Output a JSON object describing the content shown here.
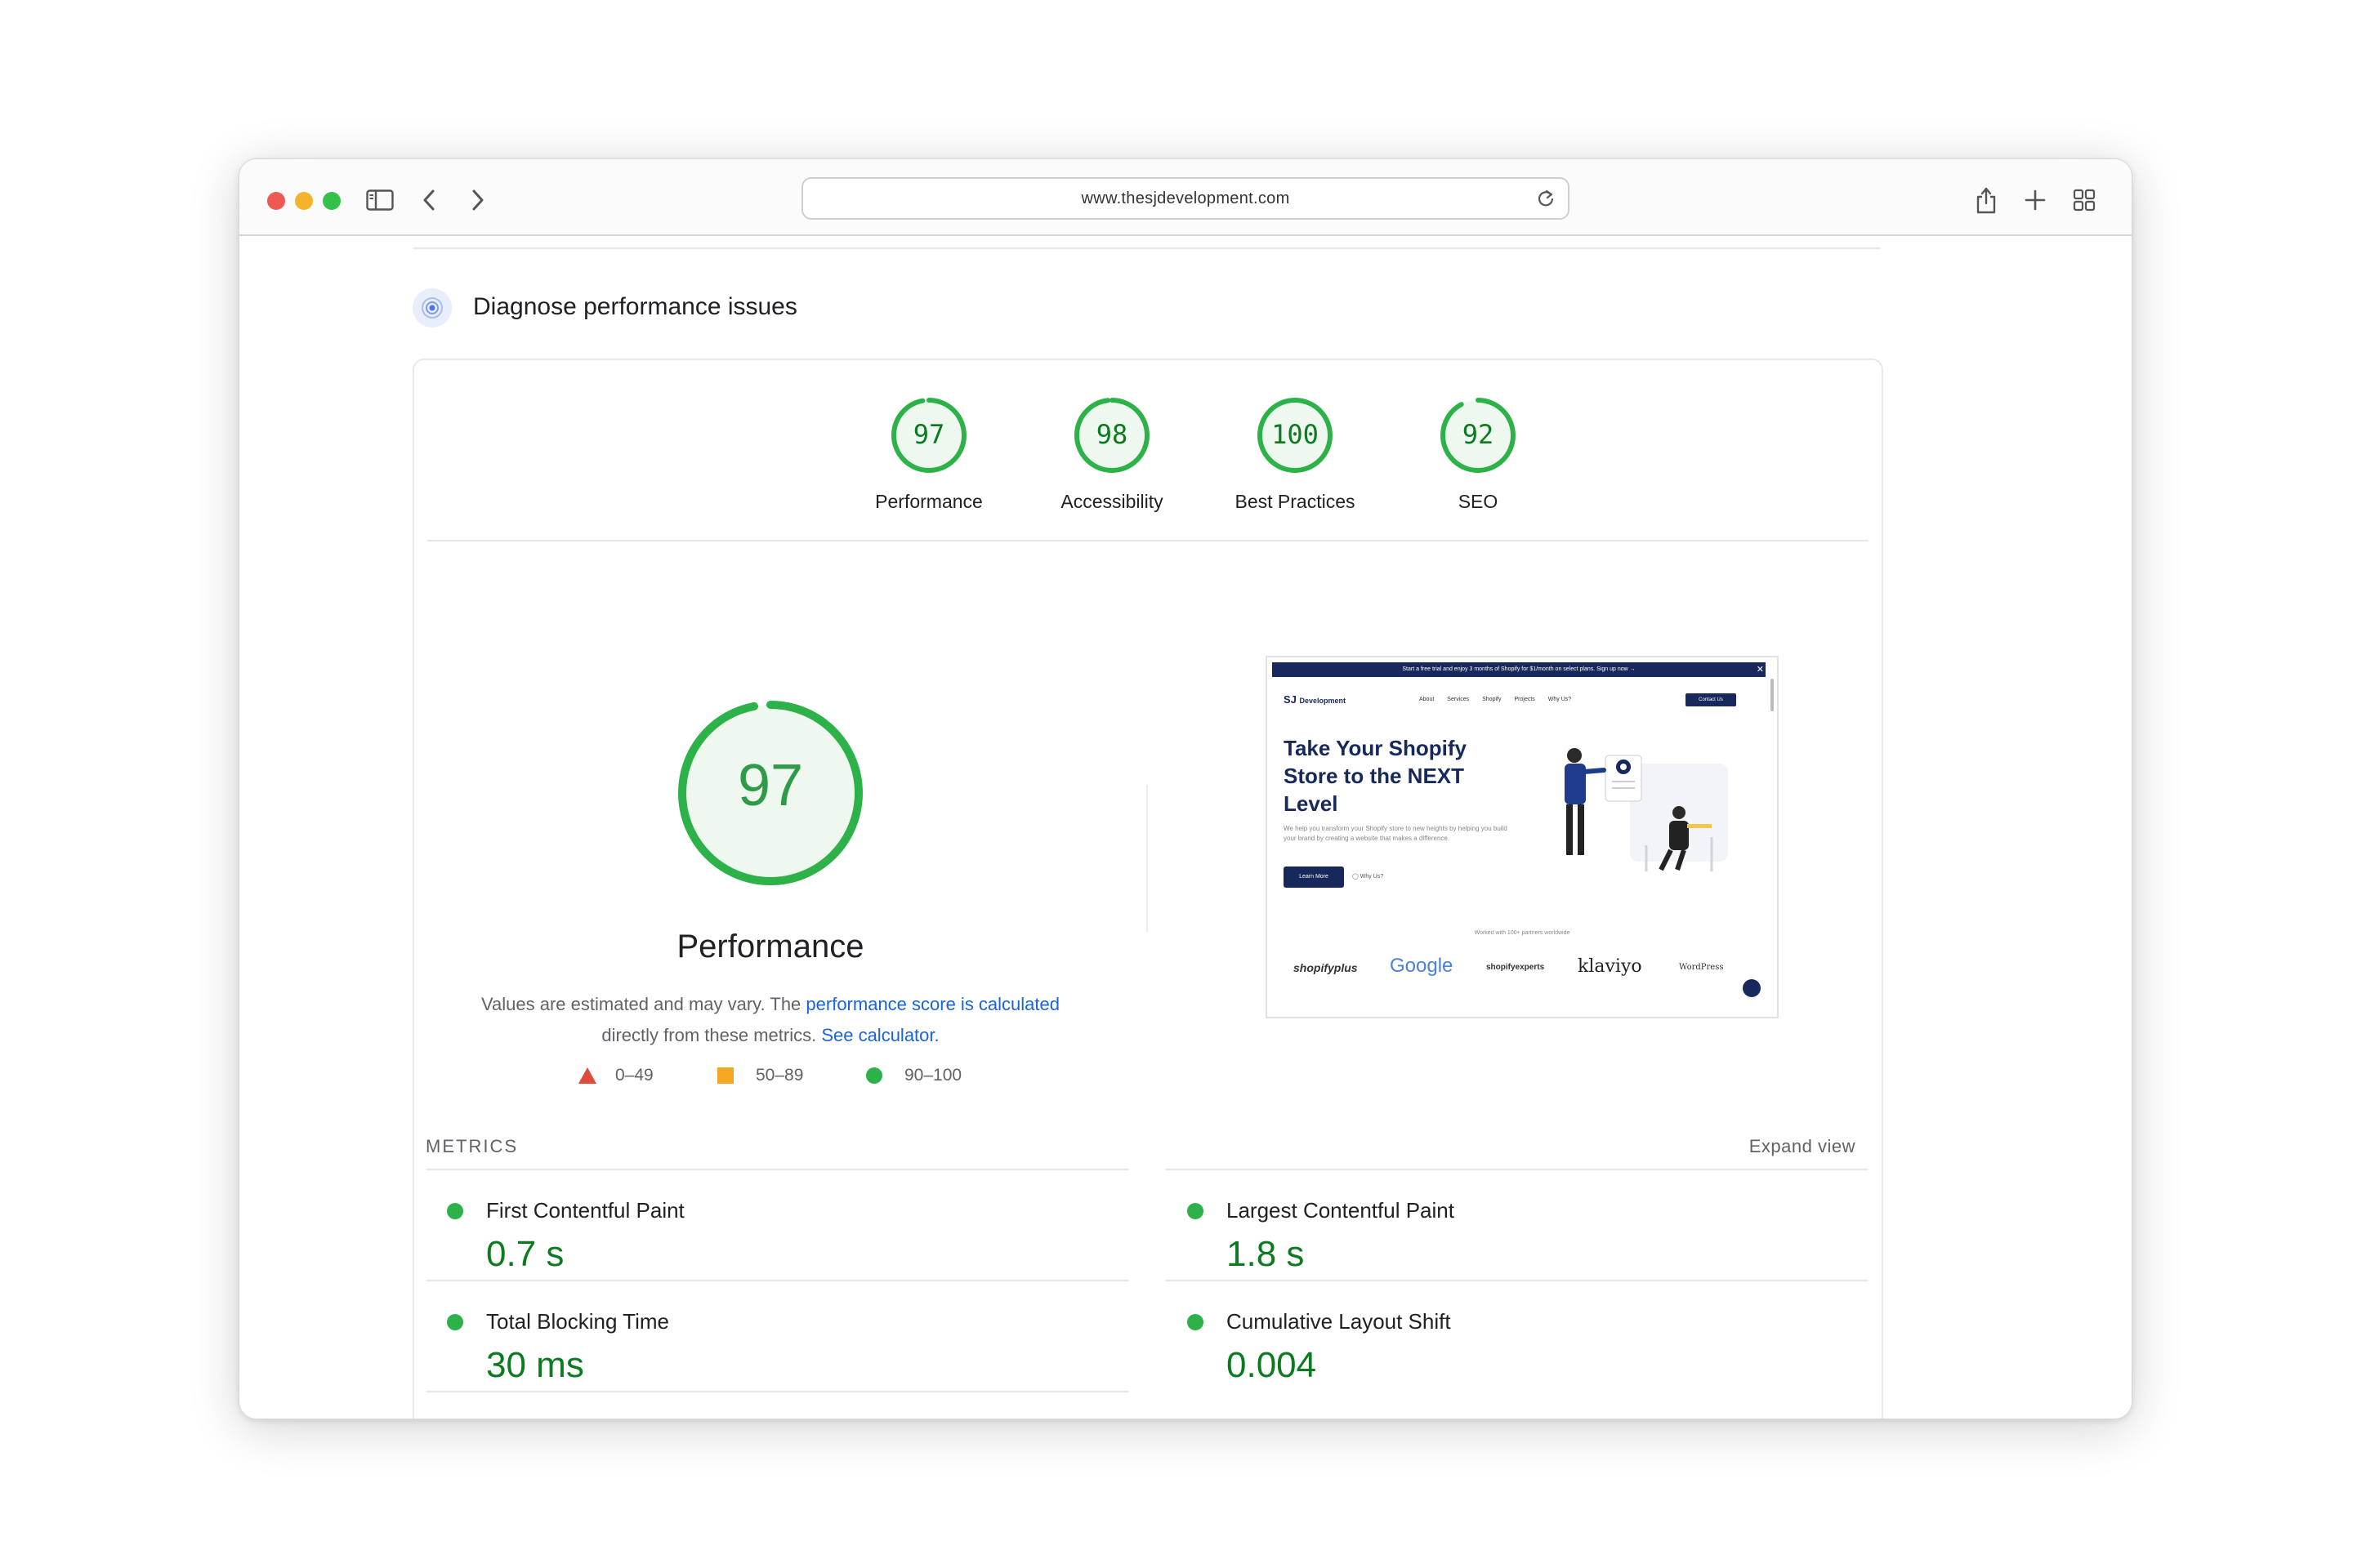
{
  "browser": {
    "url": "www.thesjdevelopment.com"
  },
  "section": {
    "title": "Diagnose performance issues"
  },
  "scores": [
    {
      "label": "Performance",
      "value": "97",
      "score": 97
    },
    {
      "label": "Accessibility",
      "value": "98",
      "score": 98
    },
    {
      "label": "Best Practices",
      "value": "100",
      "score": 100
    },
    {
      "label": "SEO",
      "value": "92",
      "score": 92
    }
  ],
  "main_gauge": {
    "value": "97",
    "score": 97,
    "label": "Performance"
  },
  "description": {
    "text1": "Values are estimated and may vary. The ",
    "link1": "performance score is calculated",
    "text2": "directly from these metrics. ",
    "link2": "See calculator."
  },
  "legend": [
    {
      "range": "0–49",
      "shape": "triangle",
      "color": "#e04a3b"
    },
    {
      "range": "50–89",
      "shape": "square",
      "color": "#f5a623"
    },
    {
      "range": "90–100",
      "shape": "circle",
      "color": "#2db24a"
    }
  ],
  "metrics": {
    "heading": "METRICS",
    "expand_label": "Expand view",
    "items": [
      {
        "name": "First Contentful Paint",
        "value": "0.7 s"
      },
      {
        "name": "Largest Contentful Paint",
        "value": "1.8 s"
      },
      {
        "name": "Total Blocking Time",
        "value": "30 ms"
      },
      {
        "name": "Cumulative Layout Shift",
        "value": "0.004"
      }
    ]
  },
  "screenshot": {
    "banner": "Start a free trial and enjoy 3 months of Shopify for $1/month on select plans. Sign up now →",
    "logo": "Development",
    "nav": [
      "About",
      "Services",
      "Shopify",
      "Projects",
      "Why Us?"
    ],
    "cta": "Contact Us",
    "headline1": "Take Your Shopify",
    "headline2": "Store to the NEXT",
    "headline3": "Level",
    "body": "We help you transform your Shopify store to new heights by helping you build your brand by creating a website that makes a difference.",
    "btn1": "Learn More",
    "btn2": "Why Us?",
    "partners_line": "Worked with 100+ partners worldwide",
    "partners": [
      "shopifyplus",
      "Google",
      "shopifyexperts",
      "klaviyo",
      "WordPress"
    ]
  },
  "colors": {
    "good": "#2db24a",
    "good_text": "#0c7a1f",
    "link": "#1a63e0",
    "navy": "#17295c"
  }
}
